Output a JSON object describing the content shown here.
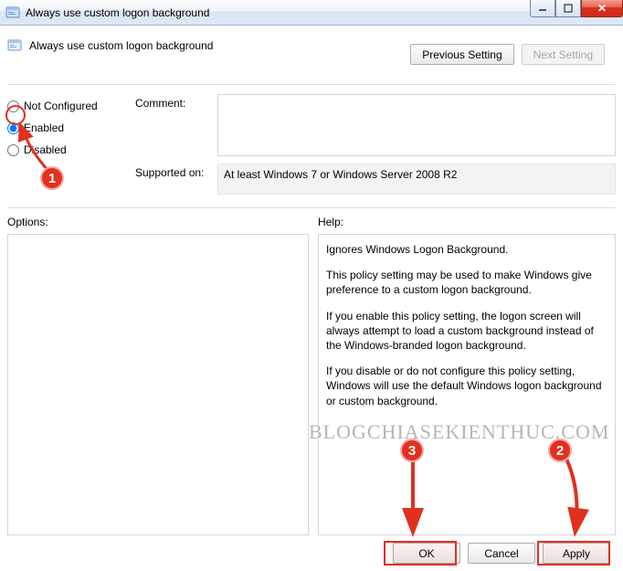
{
  "window": {
    "title": "Always use custom logon background"
  },
  "heading": "Always use custom logon background",
  "topButtons": {
    "prev": "Previous Setting",
    "next": "Next Setting"
  },
  "radios": {
    "notConfigured": "Not Configured",
    "enabled": "Enabled",
    "disabled": "Disabled",
    "selected": "enabled"
  },
  "labels": {
    "comment": "Comment:",
    "supported": "Supported on:",
    "options": "Options:",
    "help": "Help:"
  },
  "comment": "",
  "supportedOn": "At least Windows 7 or Windows Server 2008 R2",
  "help": {
    "p1": "Ignores Windows Logon Background.",
    "p2": "This policy setting may be used to make Windows give preference to a custom logon background.",
    "p3": "If you enable this policy setting, the logon screen will always attempt to load a custom background instead of the Windows-branded logon background.",
    "p4": "If you disable or do not configure this policy setting, Windows will use the default Windows logon background or custom background."
  },
  "footer": {
    "ok": "OK",
    "cancel": "Cancel",
    "apply": "Apply"
  },
  "annotations": {
    "c1": "1",
    "c2": "2",
    "c3": "3",
    "watermark": "BLOGCHIASEKIENTHUC.COM"
  }
}
